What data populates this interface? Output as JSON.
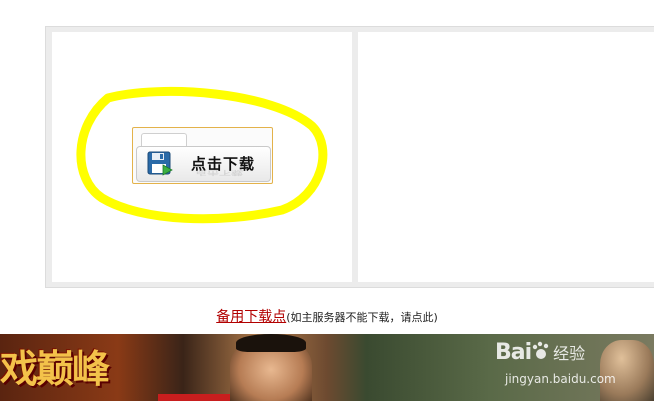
{
  "download_panel": {
    "button_label": "点击下载",
    "button_icon": "floppy-disk-icon",
    "highlight_color": "#ffff00"
  },
  "backup": {
    "link_text": "备用下载点",
    "note_text": "(如主服务器不能下载，请点此)",
    "link_color": "#b20000"
  },
  "banner": {
    "game_text": "戏巅峰",
    "watermark_logo": "Bai",
    "watermark_logo_suffix": "经验",
    "watermark_url": "jingyan.baidu.com"
  }
}
